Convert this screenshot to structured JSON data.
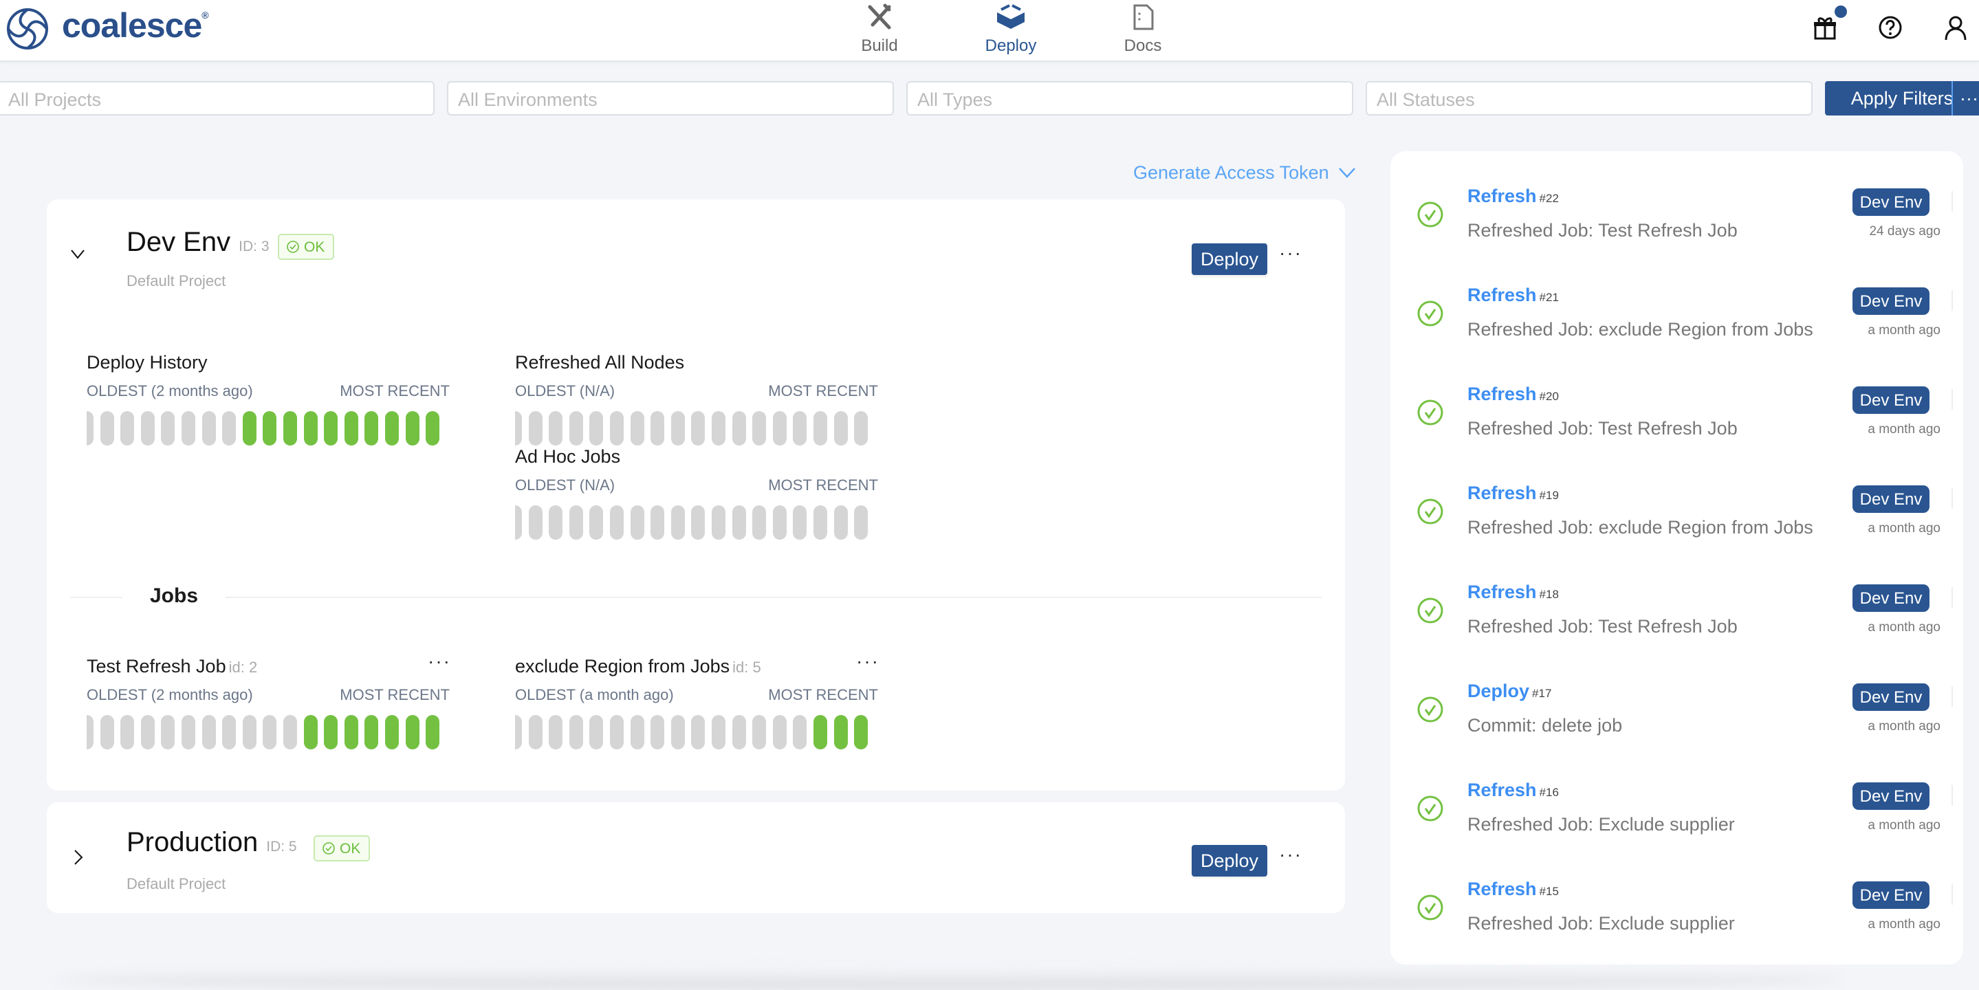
{
  "header": {
    "brand": "coalesce",
    "nav": [
      {
        "label": "Build",
        "icon": "tools-icon"
      },
      {
        "label": "Deploy",
        "icon": "deploy-icon",
        "active": true
      },
      {
        "label": "Docs",
        "icon": "docs-icon"
      }
    ],
    "notification_dot": true
  },
  "filters": {
    "projects": "All Projects",
    "environments": "All Environments",
    "types": "All Types",
    "statuses": "All Statuses",
    "apply": "Apply Filters",
    "more": "···"
  },
  "generate_token": "Generate Access Token",
  "colors": {
    "primary": "#2a5591",
    "success": "#74c142",
    "empty": "#d5d5d5",
    "link": "#3d8ef2"
  },
  "environments": [
    {
      "name": "Dev Env",
      "id": "ID: 3",
      "status": "OK",
      "project": "Default Project",
      "expanded": true,
      "deploy": "Deploy",
      "history": [
        {
          "title": "Deploy History",
          "oldest": "OLDEST (2 months ago)",
          "recent": "MOST RECENT",
          "bars": [
            "none",
            "none",
            "none",
            "none",
            "none",
            "none",
            "none",
            "none",
            "success",
            "success",
            "success",
            "success",
            "success",
            "success",
            "success",
            "success",
            "success",
            "success"
          ]
        },
        {
          "title": "Refreshed All Nodes",
          "oldest": "OLDEST (N/A)",
          "recent": "MOST RECENT",
          "bars": [
            "none",
            "none",
            "none",
            "none",
            "none",
            "none",
            "none",
            "none",
            "none",
            "none",
            "none",
            "none",
            "none",
            "none",
            "none",
            "none",
            "none",
            "none"
          ]
        },
        {
          "title": "Ad Hoc Jobs",
          "oldest": "OLDEST (N/A)",
          "recent": "MOST RECENT",
          "bars": [
            "none",
            "none",
            "none",
            "none",
            "none",
            "none",
            "none",
            "none",
            "none",
            "none",
            "none",
            "none",
            "none",
            "none",
            "none",
            "none",
            "none",
            "none"
          ]
        }
      ],
      "jobs_heading": "Jobs",
      "jobs": [
        {
          "title": "Test Refresh Job",
          "id": "id: 2",
          "oldest": "OLDEST (2 months ago)",
          "recent": "MOST RECENT",
          "bars": [
            "none",
            "none",
            "none",
            "none",
            "none",
            "none",
            "none",
            "none",
            "none",
            "none",
            "none",
            "success",
            "success",
            "success",
            "success",
            "success",
            "success",
            "success"
          ]
        },
        {
          "title": "exclude Region from Jobs",
          "id": "id: 5",
          "oldest": "OLDEST (a month ago)",
          "recent": "MOST RECENT",
          "bars": [
            "none",
            "none",
            "none",
            "none",
            "none",
            "none",
            "none",
            "none",
            "none",
            "none",
            "none",
            "none",
            "none",
            "none",
            "none",
            "success",
            "success",
            "success"
          ]
        }
      ]
    },
    {
      "name": "Production",
      "id": "ID: 5",
      "status": "OK",
      "project": "Default Project",
      "expanded": false,
      "deploy": "Deploy"
    }
  ],
  "activity": [
    {
      "type": "Refresh",
      "num": "#22",
      "desc": "Refreshed Job: Test Refresh Job",
      "env": "Dev Env",
      "time": "24 days ago"
    },
    {
      "type": "Refresh",
      "num": "#21",
      "desc": "Refreshed Job: exclude Region from Jobs",
      "env": "Dev Env",
      "time": "a month ago"
    },
    {
      "type": "Refresh",
      "num": "#20",
      "desc": "Refreshed Job: Test Refresh Job",
      "env": "Dev Env",
      "time": "a month ago"
    },
    {
      "type": "Refresh",
      "num": "#19",
      "desc": "Refreshed Job: exclude Region from Jobs",
      "env": "Dev Env",
      "time": "a month ago"
    },
    {
      "type": "Refresh",
      "num": "#18",
      "desc": "Refreshed Job: Test Refresh Job",
      "env": "Dev Env",
      "time": "a month ago"
    },
    {
      "type": "Deploy",
      "num": "#17",
      "desc": "Commit: delete job",
      "env": "Dev Env",
      "time": "a month ago"
    },
    {
      "type": "Refresh",
      "num": "#16",
      "desc": "Refreshed Job: Exclude supplier",
      "env": "Dev Env",
      "time": "a month ago"
    },
    {
      "type": "Refresh",
      "num": "#15",
      "desc": "Refreshed Job: Exclude supplier",
      "env": "Dev Env",
      "time": "a month ago"
    }
  ]
}
